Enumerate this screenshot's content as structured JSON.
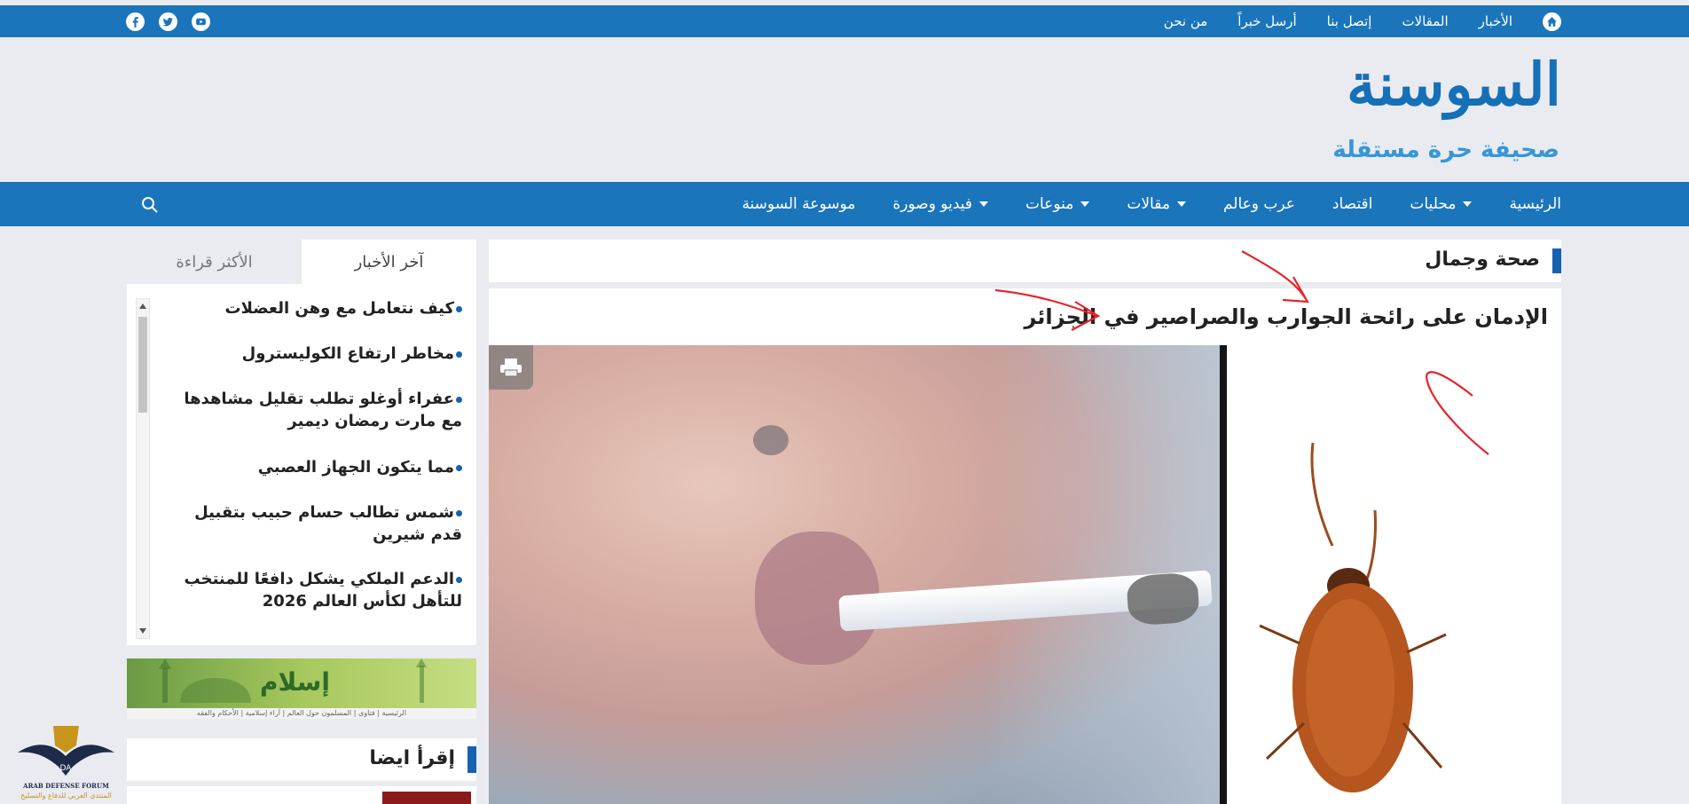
{
  "topbar": {
    "nav": [
      "الأخبار",
      "المقالات",
      "إتصل بنا",
      "أرسل خبراً",
      "من نحن"
    ]
  },
  "logo": {
    "name": "السوسنة",
    "tagline": "صحيفة حرة مستقلة"
  },
  "mainnav": {
    "items": [
      {
        "label": "الرئيسية",
        "dropdown": false
      },
      {
        "label": "محليات",
        "dropdown": true
      },
      {
        "label": "اقتصاد",
        "dropdown": false
      },
      {
        "label": "عرب وعالم",
        "dropdown": false
      },
      {
        "label": "مقالات",
        "dropdown": true
      },
      {
        "label": "منوعات",
        "dropdown": true
      },
      {
        "label": "فيديو وصورة",
        "dropdown": true
      },
      {
        "label": "موسوعة السوسنة",
        "dropdown": false
      }
    ]
  },
  "section": {
    "title": "صحة وجمال"
  },
  "article": {
    "title": "الإدمان على رائحة الجوارب والصراصير في الجزائر"
  },
  "sidebar": {
    "tabs": {
      "latest": "آخر الأخبار",
      "most_read": "الأكثر قراءة"
    },
    "news": [
      "كيف نتعامل مع وهن العضلات",
      "مخاطر ارتفاع الكوليسترول",
      "عفراء أوغلو تطلب تقليل مشاهدها مع مارت رمضان ديمير",
      "مما يتكون الجهاز العصبي",
      "شمس تطالب حسام حبيب بتقبيل قدم شيرين",
      "الدعم الملكي يشكل دافعًا للمنتخب للتأهل لكأس العالم 2026"
    ],
    "banner": {
      "title": "إسلام",
      "menu": "الرئيسية | فتاوى | المسلمون حول العالم | آراء إسلامية | الأحكام والفقه"
    },
    "read_also": "إقرأ ايضا"
  },
  "watermark": {
    "line1": "ARAB DEFENSE FORUM",
    "line2": "المنتدى العربي للدفاع والتسليح"
  },
  "colors": {
    "brand": "#1a75bb",
    "accent": "#1562b0",
    "background": "#e9ebf0",
    "annotation": "#e3262b"
  }
}
